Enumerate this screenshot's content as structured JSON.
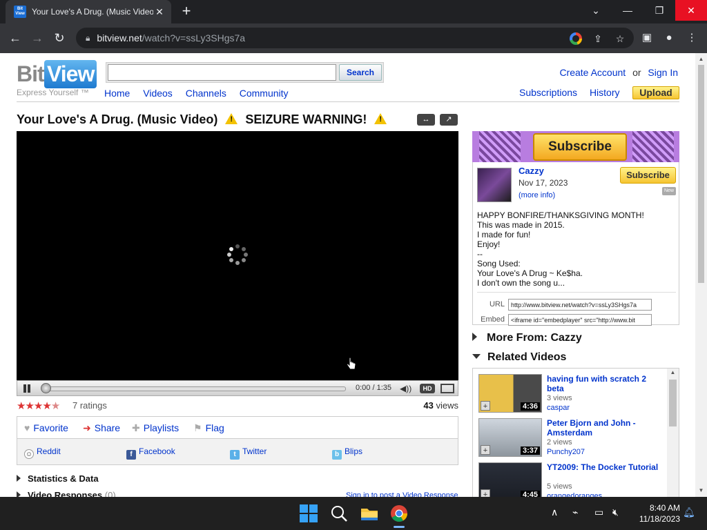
{
  "browser": {
    "tab_title": "Your Love's A Drug. (Music Video",
    "tab_favicon_text": "Bit View",
    "url_host": "bitview.net",
    "url_path": "/watch?v=ssLy3SHgs7a"
  },
  "site": {
    "logo_bit": "Bit",
    "logo_view": "View",
    "tagline": "Express Yourself ™",
    "search_button": "Search",
    "nav": [
      "Home",
      "Videos",
      "Channels",
      "Community"
    ],
    "create_account": "Create Account",
    "or": "or",
    "sign_in": "Sign In",
    "subscriptions": "Subscriptions",
    "history": "History",
    "upload": "Upload"
  },
  "video": {
    "title_part1": "Your Love's A Drug. (Music Video)",
    "title_part2": "SEIZURE WARNING!",
    "time": "0:00 / 1:35",
    "hd": "HD",
    "rating_stars": 4.5,
    "ratings_text": "7 ratings",
    "views_count": "43",
    "views_label": "views"
  },
  "actions": {
    "favorite": "Favorite",
    "share": "Share",
    "playlists": "Playlists",
    "flag": "Flag",
    "share_targets": [
      "Reddit",
      "Facebook",
      "Twitter",
      "Blips"
    ]
  },
  "sections": {
    "stats": "Statistics & Data",
    "responses": "Video Responses",
    "responses_count": "(0)",
    "sign_in_response": "Sign in to post a Video Response"
  },
  "channel": {
    "banner_subscribe": "Subscribe",
    "name": "Cazzy",
    "date": "Nov 17, 2023",
    "more_info": "(more info)",
    "subscribe": "Subscribe",
    "new_badge": "New",
    "description": [
      "HAPPY BONFIRE/THANKSGIVING MONTH!",
      "This was made in 2015.",
      "I made for fun!",
      "Enjoy!",
      "--",
      "Song Used:",
      "Your Love's A Drug ~ Ke$ha.",
      "I don't own the song u..."
    ],
    "url_label": "URL",
    "url_value": "http://www.bitview.net/watch?v=ssLy3SHgs7a",
    "embed_label": "Embed",
    "embed_value": "<iframe id=\"embedplayer\" src=\"http://www.bit"
  },
  "sidebar": {
    "more_from": "More From: Cazzy",
    "related": "Related Videos",
    "related_videos": [
      {
        "title": "having fun with scratch 2 beta",
        "views": "3 views",
        "author": "caspar",
        "duration": "4:36"
      },
      {
        "title": "Peter Bjorn and John - Amsterdam",
        "views": "2 views",
        "author": "Punchy207",
        "duration": "3:37"
      },
      {
        "title": "YT2009: The Docker Tutorial",
        "views": "5 views",
        "author": "orangedoranges",
        "duration": "4:45"
      }
    ]
  },
  "taskbar": {
    "time": "8:40 AM",
    "date": "11/18/2023"
  }
}
